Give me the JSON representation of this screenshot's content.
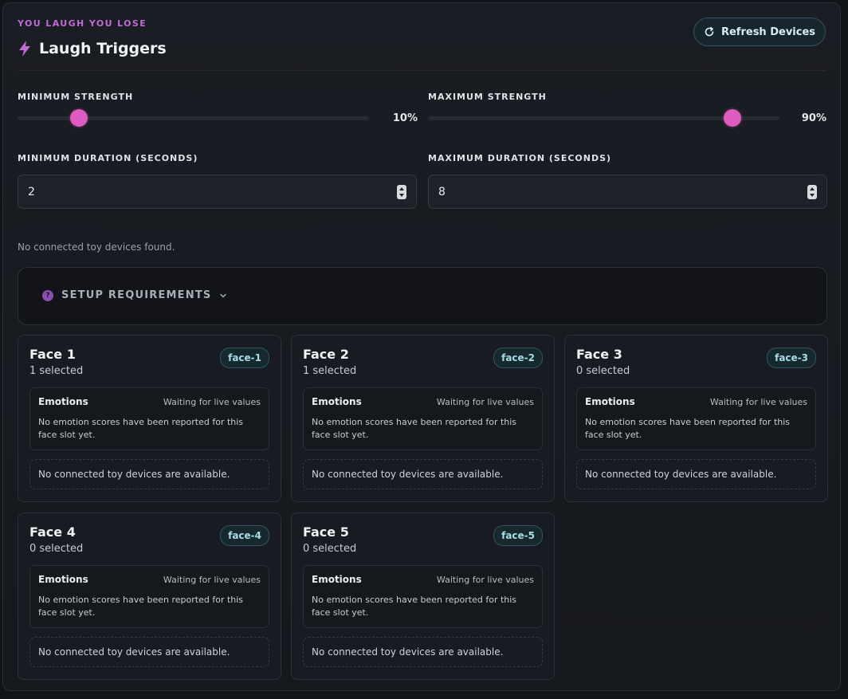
{
  "header": {
    "eyebrow": "YOU LAUGH YOU LOSE",
    "title": "Laugh Triggers",
    "refresh_label": "Refresh Devices",
    "accent": "#c06bd6"
  },
  "settings": {
    "min_strength": {
      "label": "MINIMUM STRENGTH",
      "value": 10,
      "display": "10%"
    },
    "max_strength": {
      "label": "MAXIMUM STRENGTH",
      "value": 90,
      "display": "90%"
    },
    "min_duration": {
      "label": "MINIMUM DURATION (SECONDS)",
      "value": "2"
    },
    "max_duration": {
      "label": "MAXIMUM DURATION (SECONDS)",
      "value": "8"
    }
  },
  "devices_note": "No connected toy devices found.",
  "setup": {
    "label": "SETUP REQUIREMENTS",
    "icon": "question-icon"
  },
  "faces": [
    {
      "name": "Face 1",
      "selected": "1 selected",
      "id": "face-1",
      "emotions_title": "Emotions",
      "emotions_status": "Waiting for live values",
      "emotions_desc": "No emotion scores have been reported for this face slot yet.",
      "devices": "No connected toy devices are available."
    },
    {
      "name": "Face 2",
      "selected": "1 selected",
      "id": "face-2",
      "emotions_title": "Emotions",
      "emotions_status": "Waiting for live values",
      "emotions_desc": "No emotion scores have been reported for this face slot yet.",
      "devices": "No connected toy devices are available."
    },
    {
      "name": "Face 3",
      "selected": "0 selected",
      "id": "face-3",
      "emotions_title": "Emotions",
      "emotions_status": "Waiting for live values",
      "emotions_desc": "No emotion scores have been reported for this face slot yet.",
      "devices": "No connected toy devices are available."
    },
    {
      "name": "Face 4",
      "selected": "0 selected",
      "id": "face-4",
      "emotions_title": "Emotions",
      "emotions_status": "Waiting for live values",
      "emotions_desc": "No emotion scores have been reported for this face slot yet.",
      "devices": "No connected toy devices are available."
    },
    {
      "name": "Face 5",
      "selected": "0 selected",
      "id": "face-5",
      "emotions_title": "Emotions",
      "emotions_status": "Waiting for live values",
      "emotions_desc": "No emotion scores have been reported for this face slot yet.",
      "devices": "No connected toy devices are available."
    }
  ]
}
